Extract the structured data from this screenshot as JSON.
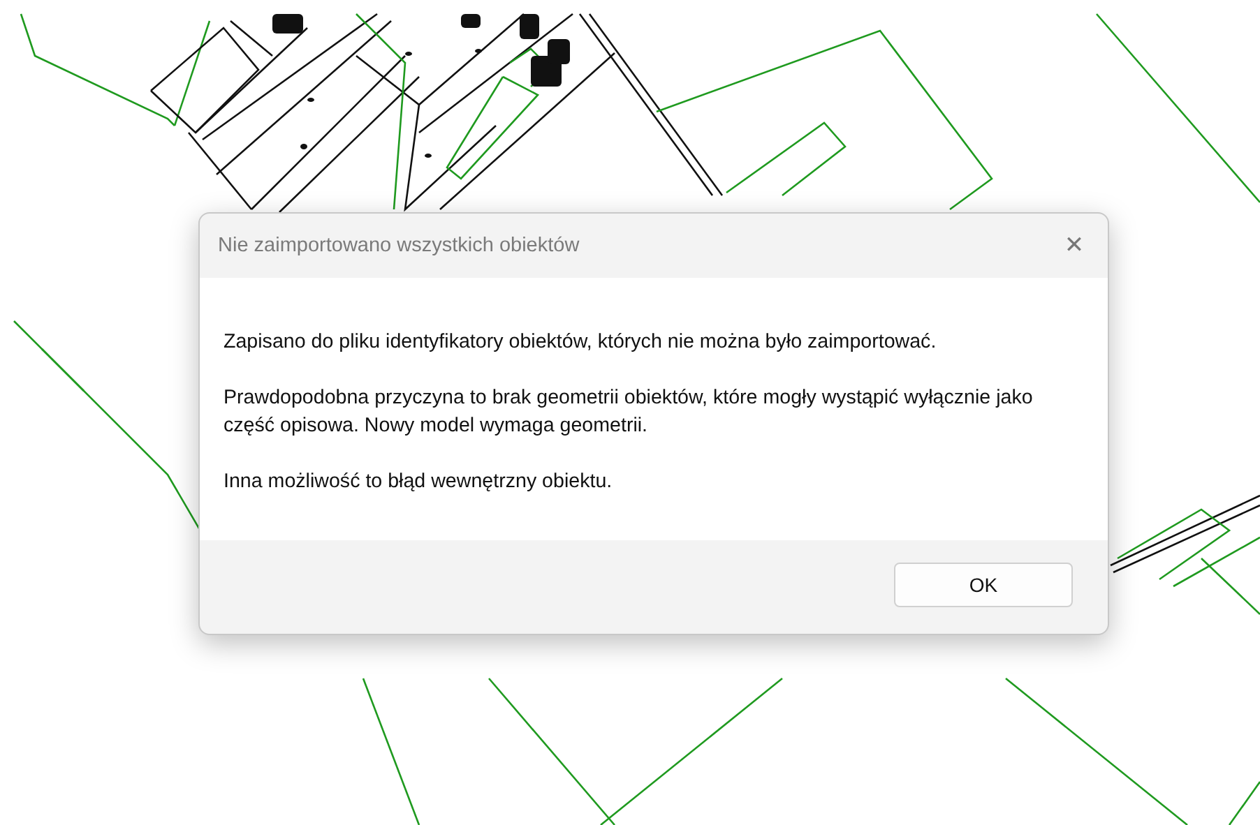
{
  "dialog": {
    "title": "Nie zaimportowano wszystkich obiektów",
    "close_glyph": "✕",
    "paragraphs": [
      "Zapisano do pliku identyfikatory obiektów, których nie można było zaimportować.",
      "Prawdopodobna przyczyna to brak geometrii obiektów, które mogły wystąpić wyłącznie jako część opisowa. Nowy model wymaga geometrii.",
      "Inna możliwość to błąd wewnętrzny obiektu."
    ],
    "buttons": [
      "OK"
    ]
  }
}
